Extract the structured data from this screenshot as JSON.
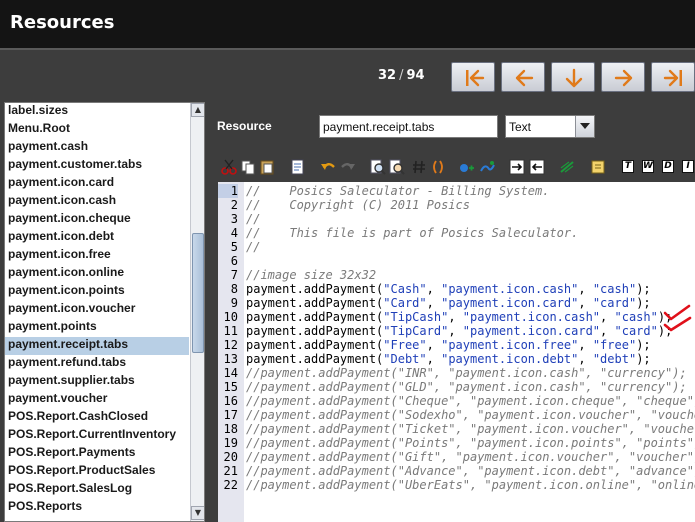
{
  "window": {
    "title": "Resources"
  },
  "navigation": {
    "current": "32",
    "separator": "/",
    "total": "94"
  },
  "resource_list": [
    "label.sizes",
    "Menu.Root",
    "payment.cash",
    "payment.customer.tabs",
    "payment.icon.card",
    "payment.icon.cash",
    "payment.icon.cheque",
    "payment.icon.debt",
    "payment.icon.free",
    "payment.icon.online",
    "payment.icon.points",
    "payment.icon.voucher",
    "payment.points",
    "payment.receipt.tabs",
    "payment.refund.tabs",
    "payment.supplier.tabs",
    "payment.voucher",
    "POS.Report.CashClosed",
    "POS.Report.CurrentInventory",
    "POS.Report.Payments",
    "POS.Report.ProductSales",
    "POS.Report.SalesLog",
    "POS.Reports"
  ],
  "selected_index": 13,
  "form": {
    "resource_label": "Resource",
    "resource_value": "payment.receipt.tabs",
    "type_value": "Text"
  },
  "toolbar": {
    "text_buttons": [
      "T",
      "W",
      "D",
      "I"
    ]
  },
  "editor": {
    "current_line": 1,
    "lines": [
      {
        "n": "1",
        "kind": "comment",
        "text": "//    Posics Saleculator - Billing System."
      },
      {
        "n": "2",
        "kind": "comment",
        "text": "//    Copyright (C) 2011 Posics"
      },
      {
        "n": "3",
        "kind": "comment",
        "text": "//"
      },
      {
        "n": "4",
        "kind": "comment",
        "text": "//    This file is part of Posics Saleculator."
      },
      {
        "n": "5",
        "kind": "comment",
        "text": "//"
      },
      {
        "n": "6",
        "kind": "blank",
        "text": ""
      },
      {
        "n": "7",
        "kind": "comment",
        "text": "//image size 32x32"
      },
      {
        "n": "8",
        "kind": "code",
        "call": "payment.addPayment(",
        "args": [
          "\"Cash\"",
          "\"payment.icon.cash\"",
          "\"cash\""
        ],
        "end": ");"
      },
      {
        "n": "9",
        "kind": "code",
        "call": "payment.addPayment(",
        "args": [
          "\"Card\"",
          "\"payment.icon.card\"",
          "\"card\""
        ],
        "end": ");"
      },
      {
        "n": "10",
        "kind": "code",
        "call": "payment.addPayment(",
        "args": [
          "\"TipCash\"",
          "\"payment.icon.cash\"",
          "\"cash\""
        ],
        "end": ");"
      },
      {
        "n": "11",
        "kind": "code",
        "call": "payment.addPayment(",
        "args": [
          "\"TipCard\"",
          "\"payment.icon.card\"",
          "\"card\""
        ],
        "end": ");"
      },
      {
        "n": "12",
        "kind": "code",
        "call": "payment.addPayment(",
        "args": [
          "\"Free\"",
          "\"payment.icon.free\"",
          "\"free\""
        ],
        "end": ");"
      },
      {
        "n": "13",
        "kind": "code",
        "call": "payment.addPayment(",
        "args": [
          "\"Debt\"",
          "\"payment.icon.debt\"",
          "\"debt\""
        ],
        "end": ");"
      },
      {
        "n": "14",
        "kind": "comment",
        "text": "//payment.addPayment(\"INR\", \"payment.icon.cash\", \"currency\");"
      },
      {
        "n": "15",
        "kind": "comment",
        "text": "//payment.addPayment(\"GLD\", \"payment.icon.cash\", \"currency\");"
      },
      {
        "n": "16",
        "kind": "comment",
        "text": "//payment.addPayment(\"Cheque\", \"payment.icon.cheque\", \"cheque\");"
      },
      {
        "n": "17",
        "kind": "comment",
        "text": "//payment.addPayment(\"Sodexho\", \"payment.icon.voucher\", \"voucher\");"
      },
      {
        "n": "18",
        "kind": "comment",
        "text": "//payment.addPayment(\"Ticket\", \"payment.icon.voucher\", \"voucher\");"
      },
      {
        "n": "19",
        "kind": "comment",
        "text": "//payment.addPayment(\"Points\", \"payment.icon.points\", \"points\");"
      },
      {
        "n": "20",
        "kind": "comment",
        "text": "//payment.addPayment(\"Gift\", \"payment.icon.voucher\", \"voucher\");"
      },
      {
        "n": "21",
        "kind": "comment",
        "text": "//payment.addPayment(\"Advance\", \"payment.icon.debt\", \"advance\");"
      },
      {
        "n": "22",
        "kind": "comment",
        "text": "//payment.addPayment(\"UberEats\", \"payment.icon.online\", \"online\");"
      }
    ],
    "checkmarked_lines": [
      "10",
      "11"
    ]
  },
  "colors": {
    "title_bar": "#141414",
    "background": "#3d3d3d",
    "selected_row": "#b8cfe5",
    "string": "#1f3fb8",
    "comment": "#7a7a7a",
    "checkmark": "#e0101a"
  }
}
